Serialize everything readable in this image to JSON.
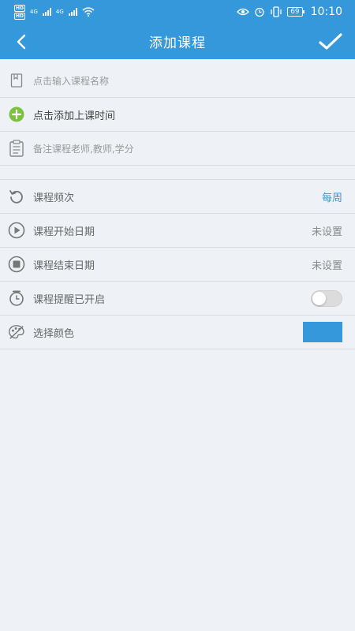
{
  "status_bar": {
    "hd_top": "HD",
    "hd_bottom": "HD",
    "net1": "4G",
    "net2": "4G",
    "battery": "69",
    "time": "10:10"
  },
  "header": {
    "title": "添加课程"
  },
  "form": {
    "course_name_placeholder": "点击输入课程名称",
    "add_time_label": "点击添加上课时间",
    "notes_placeholder": "备注课程老师,教师,学分"
  },
  "settings": {
    "frequency": {
      "label": "课程频次",
      "value": "每周"
    },
    "start_date": {
      "label": "课程开始日期",
      "value": "未设置"
    },
    "end_date": {
      "label": "课程结束日期",
      "value": "未设置"
    },
    "reminder": {
      "label": "课程提醒已开启",
      "enabled": false
    },
    "color": {
      "label": "选择颜色",
      "value_color": "#3498db"
    }
  },
  "colors": {
    "primary": "#3498db",
    "add_green": "#7cc23f",
    "icon_gray": "#777777"
  }
}
